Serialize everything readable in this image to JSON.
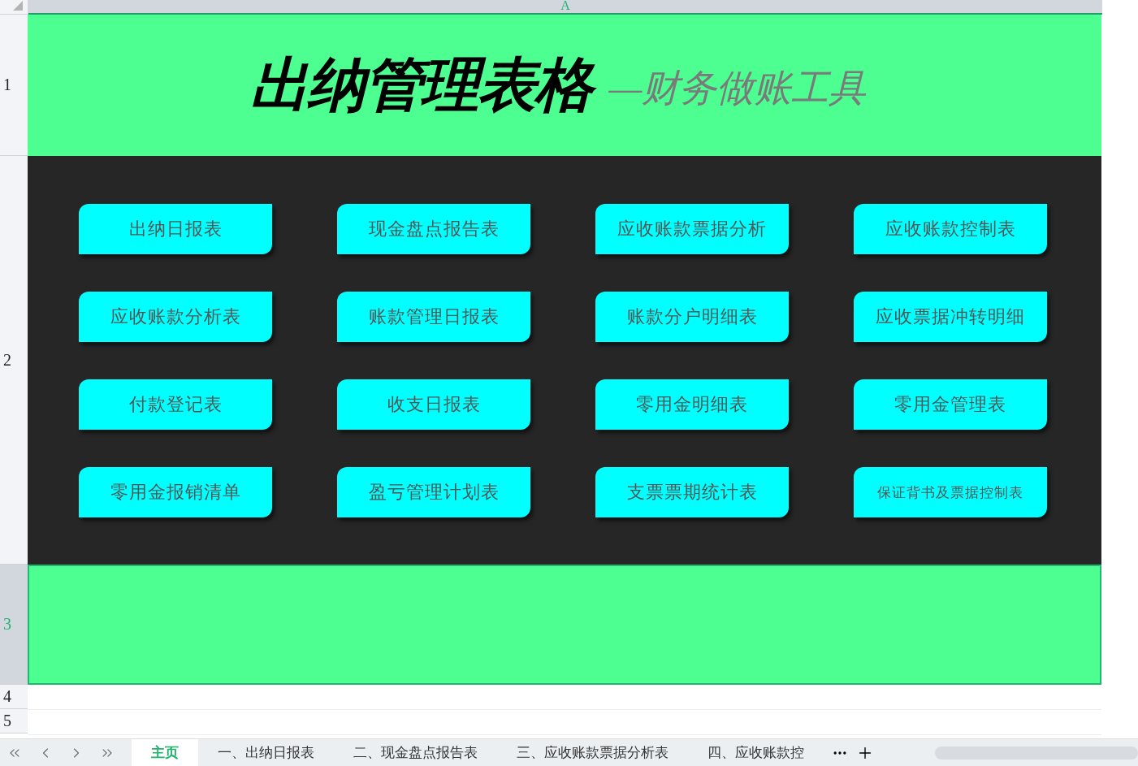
{
  "column_header": "A",
  "rows": [
    {
      "number": "1",
      "selected": false
    },
    {
      "number": "2",
      "selected": false
    },
    {
      "number": "3",
      "selected": true
    },
    {
      "number": "4",
      "selected": false
    },
    {
      "number": "5",
      "selected": false
    }
  ],
  "title": "出纳管理表格",
  "subtitle": "—财务做账工具",
  "buttons": [
    {
      "label": "出纳日报表",
      "kind": "normal"
    },
    {
      "label": "现金盘点报告表",
      "kind": "normal"
    },
    {
      "label": "应收账款票据分析",
      "kind": "normal"
    },
    {
      "label": "应收账款控制表",
      "kind": "normal"
    },
    {
      "label": "应收账款分析表",
      "kind": "normal"
    },
    {
      "label": "账款管理日报表",
      "kind": "normal"
    },
    {
      "label": "账款分户明细表",
      "kind": "normal"
    },
    {
      "label": "应收票据冲转明细",
      "kind": "normal"
    },
    {
      "label": "付款登记表",
      "kind": "normal"
    },
    {
      "label": "收支日报表",
      "kind": "normal"
    },
    {
      "label": "零用金明细表",
      "kind": "normal"
    },
    {
      "label": "零用金管理表",
      "kind": "normal"
    },
    {
      "label": "零用金报销清单",
      "kind": "normal"
    },
    {
      "label": "盈亏管理计划表",
      "kind": "normal"
    },
    {
      "label": "支票票期统计表",
      "kind": "normal"
    },
    {
      "label": "保证背书及票据控制表",
      "kind": "small"
    }
  ],
  "sheet_tabs": [
    {
      "label": "主页",
      "selected": true
    },
    {
      "label": "一、出纳日报表",
      "selected": false
    },
    {
      "label": "二、现金盘点报告表",
      "selected": false
    },
    {
      "label": "三、应收账款票据分析表",
      "selected": false
    },
    {
      "label": "四、应收账款控",
      "selected": false
    }
  ]
}
